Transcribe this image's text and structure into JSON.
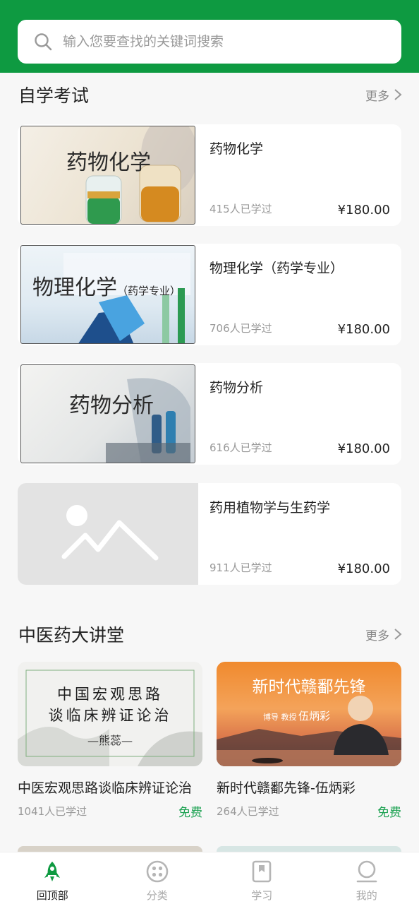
{
  "search": {
    "placeholder": "输入您要查找的关键词搜索"
  },
  "section_self_study": {
    "title": "自学考试",
    "more_label": "更多"
  },
  "courses": [
    {
      "title": "药物化学",
      "thumb_text": "药物化学",
      "learners": "415人已学过",
      "price": "¥180.00"
    },
    {
      "title": "物理化学（药学专业）",
      "thumb_text": "物理化学",
      "thumb_sub": "（药学专业）",
      "learners": "706人已学过",
      "price": "¥180.00"
    },
    {
      "title": "药物分析",
      "thumb_text": "药物分析",
      "learners": "616人已学过",
      "price": "¥180.00"
    },
    {
      "title": "药用植物学与生药学",
      "learners": "911人已学过",
      "price": "¥180.00"
    }
  ],
  "section_tcm": {
    "title": "中医药大讲堂",
    "more_label": "更多"
  },
  "lectures": [
    {
      "title": "中医宏观思路谈临床辨证论治",
      "thumb_line1": "中国宏观思路",
      "thumb_line2": "谈临床辨证论治",
      "thumb_author": "—熊蕊—",
      "learners": "1041人已学过",
      "price": "免费"
    },
    {
      "title": "新时代赣鄱先锋-伍炳彩",
      "thumb_line1": "新时代赣鄱先锋",
      "thumb_caption": "博导 教授",
      "thumb_name": "伍炳彩",
      "learners": "264人已学过",
      "price": "免费"
    }
  ],
  "tabbar": [
    {
      "label": "回顶部",
      "icon": "rocket-icon",
      "active": true
    },
    {
      "label": "分类",
      "icon": "category-icon",
      "active": false
    },
    {
      "label": "学习",
      "icon": "book-icon",
      "active": false
    },
    {
      "label": "我的",
      "icon": "profile-icon",
      "active": false
    }
  ],
  "colors": {
    "brand_green": "#0e9a41",
    "free_green": "#1aa150",
    "background": "#f7f7f7"
  }
}
